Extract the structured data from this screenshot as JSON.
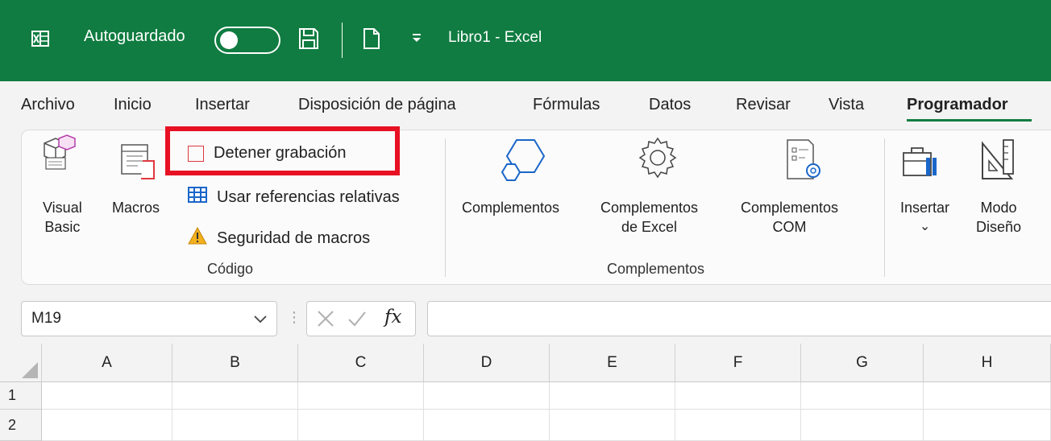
{
  "titlebar": {
    "autosave_label": "Autoguardado",
    "document_title": "Libro1  -  Excel"
  },
  "tabs": [
    {
      "label": "Archivo"
    },
    {
      "label": "Inicio"
    },
    {
      "label": "Insertar"
    },
    {
      "label": "Disposición de página"
    },
    {
      "label": "Fórmulas"
    },
    {
      "label": "Datos"
    },
    {
      "label": "Revisar"
    },
    {
      "label": "Vista"
    },
    {
      "label": "Programador"
    }
  ],
  "ribbon": {
    "codigo": {
      "group_label": "Código",
      "visual_basic": [
        "Visual",
        "Basic"
      ],
      "macros": "Macros",
      "stop_recording": "Detener grabación",
      "relative_refs": "Usar referencias relativas",
      "macro_security": "Seguridad de macros"
    },
    "complementos": {
      "group_label": "Complementos",
      "addins": "Complementos",
      "excel_addins": [
        "Complementos",
        "de Excel"
      ],
      "com_addins": [
        "Complementos",
        "COM"
      ]
    },
    "controles": {
      "insert": "Insertar",
      "insert_arrow": "⌄",
      "design_mode": [
        "Modo",
        "Diseño"
      ]
    }
  },
  "formula_bar": {
    "name_box": "M19",
    "fx": "fx",
    "value": ""
  },
  "grid": {
    "columns": [
      "A",
      "B",
      "C",
      "D",
      "E",
      "F",
      "G",
      "H"
    ],
    "rows": [
      "1",
      "2"
    ]
  },
  "colors": {
    "title_bg": "#107c41",
    "highlight": "#e81123",
    "stop_icon": "#e0383e",
    "table_icon": "#1a66c9"
  }
}
